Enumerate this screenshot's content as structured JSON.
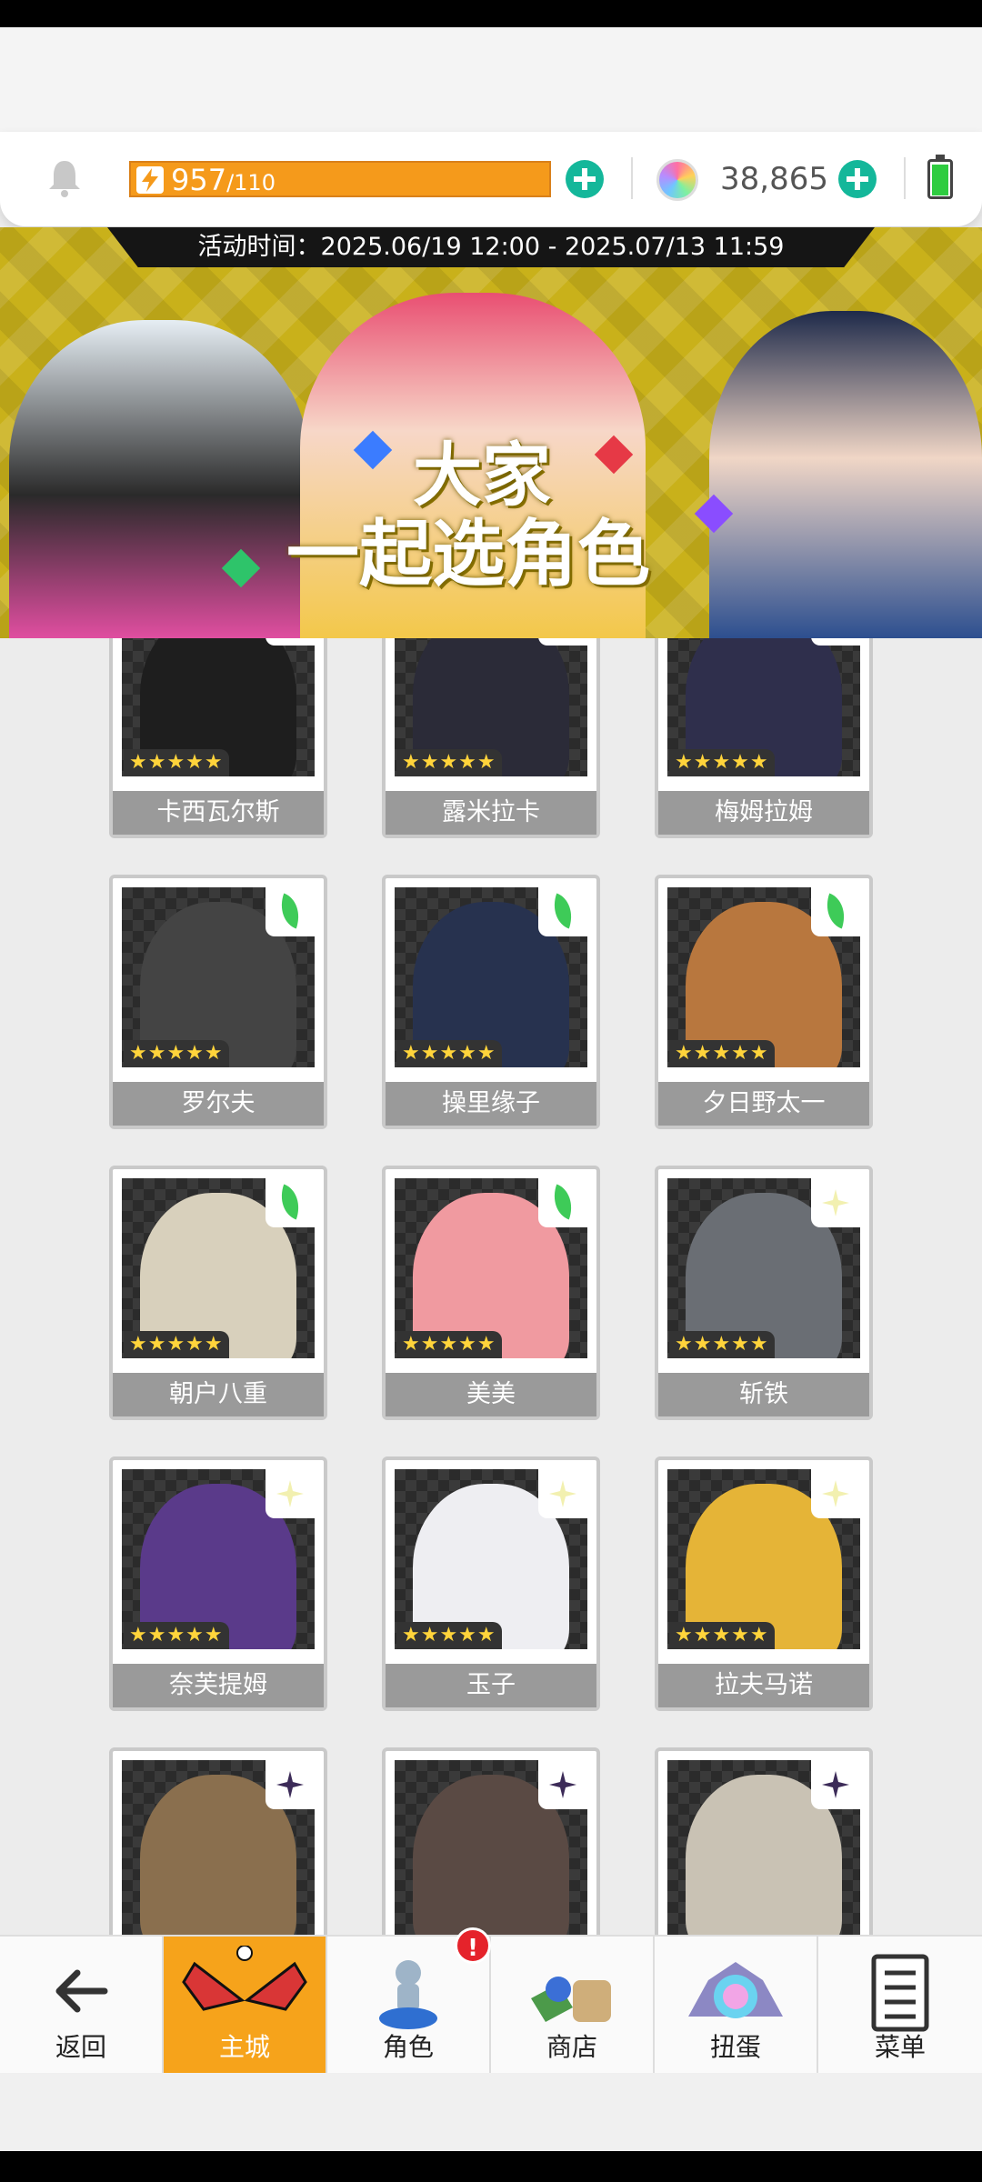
{
  "topbar": {
    "energy_current": "957",
    "energy_max": "/110",
    "energy_fill_fraction": 1.0,
    "gem_count": "38,865",
    "colors": {
      "energy": "#f59a1b",
      "plus": "#14b79a",
      "battery": "#2ecc40"
    }
  },
  "banner": {
    "event_time": "活动时间：2025.06/19 12:00 - 2025.07/13 11:59",
    "title_line1": "大家",
    "title_line2": "一起选角色"
  },
  "characters": [
    {
      "name": "卡西瓦尔斯",
      "stars": "★★★★★",
      "rarity_icon": "leaf-icon",
      "portrait": "#1e1e1e"
    },
    {
      "name": "露米拉卡",
      "stars": "★★★★★",
      "rarity_icon": "leaf-icon",
      "portrait": "#2b2b38"
    },
    {
      "name": "梅姆拉姆",
      "stars": "★★★★★",
      "rarity_icon": "leaf-icon",
      "portrait": "#2f2f4c"
    },
    {
      "name": "罗尔夫",
      "stars": "★★★★★",
      "rarity_icon": "leaf-icon",
      "portrait": "#444"
    },
    {
      "name": "操里缘子",
      "stars": "★★★★★",
      "rarity_icon": "leaf-icon",
      "portrait": "#27324f"
    },
    {
      "name": "夕日野太一",
      "stars": "★★★★★",
      "rarity_icon": "leaf-icon",
      "portrait": "#b8773e"
    },
    {
      "name": "朝户八重",
      "stars": "★★★★★",
      "rarity_icon": "leaf-icon",
      "portrait": "#d8d0bc"
    },
    {
      "name": "美美",
      "stars": "★★★★★",
      "rarity_icon": "leaf-icon",
      "portrait": "#f09aa0"
    },
    {
      "name": "斩铁",
      "stars": "★★★★★",
      "rarity_icon": "sparkle-icon",
      "portrait": "#6a6e74"
    },
    {
      "name": "奈芙提姆",
      "stars": "★★★★★",
      "rarity_icon": "sparkle-icon",
      "portrait": "#5a3a8a"
    },
    {
      "name": "玉子",
      "stars": "★★★★★",
      "rarity_icon": "sparkle-icon",
      "portrait": "#eeeef2"
    },
    {
      "name": "拉夫马诺",
      "stars": "★★★★★",
      "rarity_icon": "sparkle-icon",
      "portrait": "#e5b437"
    },
    {
      "name": "",
      "stars": "",
      "rarity_icon": "dark-sparkle-icon",
      "portrait": "#8a6f4e"
    },
    {
      "name": "",
      "stars": "",
      "rarity_icon": "dark-sparkle-icon",
      "portrait": "#5a4a44"
    },
    {
      "name": "",
      "stars": "",
      "rarity_icon": "dark-sparkle-icon",
      "portrait": "#c9c2b4"
    }
  ],
  "nav": {
    "back": "返回",
    "main_city": "主城",
    "characters": "角色",
    "shop": "商店",
    "gacha": "扭蛋",
    "menu": "菜单",
    "characters_badge": "!"
  }
}
